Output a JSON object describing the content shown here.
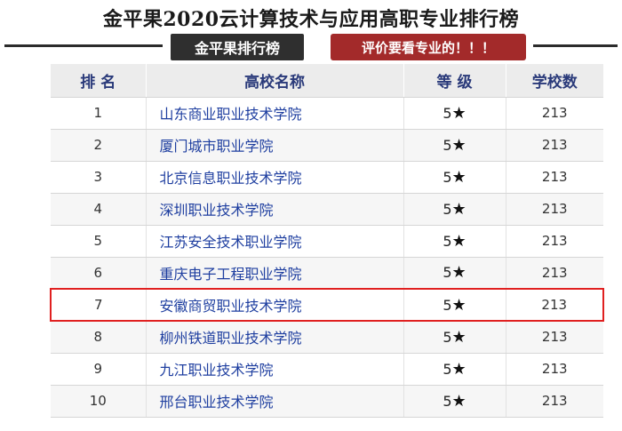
{
  "title": "金平果2020云计算技术与应用高职专业排行榜",
  "banner": {
    "dark_tag": "金平果排行榜",
    "red_tag": "评价要看专业的！！！"
  },
  "table": {
    "headers": [
      "排 名",
      "高校名称",
      "等 级",
      "学校数"
    ],
    "highlight_rank": "7",
    "rows": [
      {
        "rank": "1",
        "name": "山东商业职业技术学院",
        "grade": "5",
        "star": "★",
        "count": "213"
      },
      {
        "rank": "2",
        "name": "厦门城市职业学院",
        "grade": "5",
        "star": "★",
        "count": "213"
      },
      {
        "rank": "3",
        "name": "北京信息职业技术学院",
        "grade": "5",
        "star": "★",
        "count": "213"
      },
      {
        "rank": "4",
        "name": "深圳职业技术学院",
        "grade": "5",
        "star": "★",
        "count": "213"
      },
      {
        "rank": "5",
        "name": "江苏安全技术职业学院",
        "grade": "5",
        "star": "★",
        "count": "213"
      },
      {
        "rank": "6",
        "name": "重庆电子工程职业学院",
        "grade": "5",
        "star": "★",
        "count": "213"
      },
      {
        "rank": "7",
        "name": "安徽商贸职业技术学院",
        "grade": "5",
        "star": "★",
        "count": "213"
      },
      {
        "rank": "8",
        "name": "柳州铁道职业技术学院",
        "grade": "5",
        "star": "★",
        "count": "213"
      },
      {
        "rank": "9",
        "name": "九江职业技术学院",
        "grade": "5",
        "star": "★",
        "count": "213"
      },
      {
        "rank": "10",
        "name": "邢台职业技术学院",
        "grade": "5",
        "star": "★",
        "count": "213"
      }
    ]
  }
}
